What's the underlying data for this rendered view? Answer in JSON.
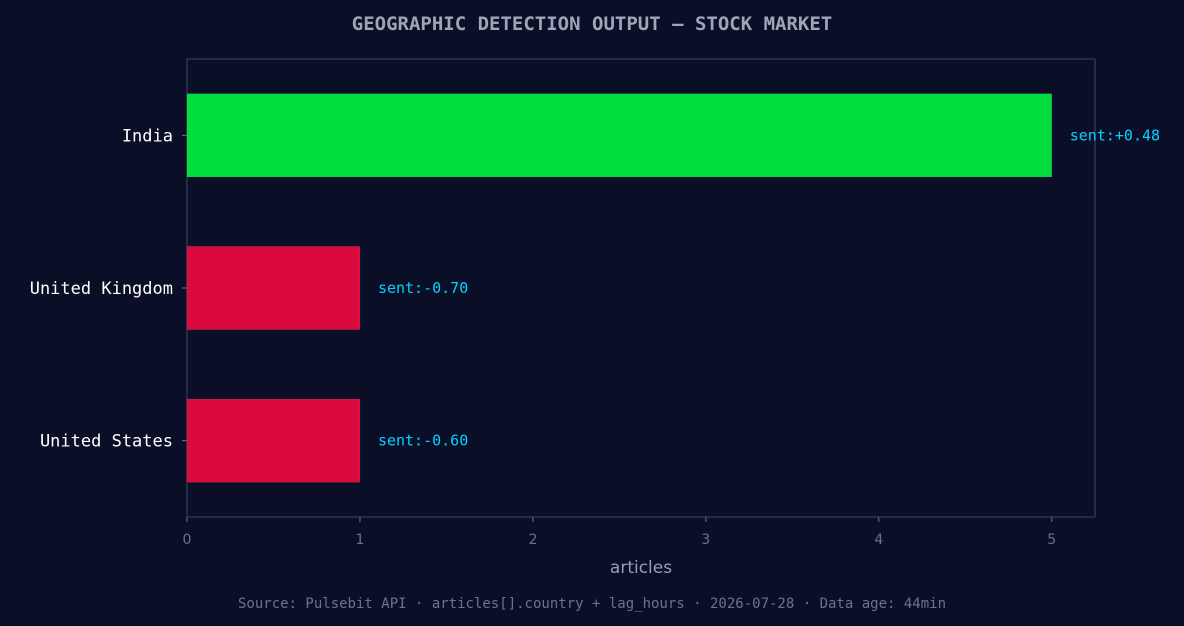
{
  "chart_data": {
    "type": "bar",
    "orientation": "horizontal",
    "title": "GEOGRAPHIC DETECTION OUTPUT — STOCK MARKET",
    "xlabel": "articles",
    "ylabel": "",
    "xlim": [
      0,
      5.25
    ],
    "xticks": [
      0,
      1,
      2,
      3,
      4,
      5
    ],
    "categories": [
      "India",
      "United Kingdom",
      "United States"
    ],
    "values": [
      5,
      1,
      1
    ],
    "annotations": [
      "sent:+0.48",
      "sent:-0.70",
      "sent:-0.60"
    ],
    "bar_colors": [
      "#00dd3e",
      "#dc0a3c",
      "#dc0a3c"
    ],
    "annotation_color": "#00d4ff",
    "grid": false,
    "legend": "none",
    "footer": "Source: Pulsebit API · articles[].country + lag_hours · 2026-07-28 · Data age: 44min"
  },
  "colors": {
    "background": "#0a0e27",
    "axes_frame": "#2e3350",
    "positive": "#00dd3e",
    "negative": "#dc0a3c"
  }
}
